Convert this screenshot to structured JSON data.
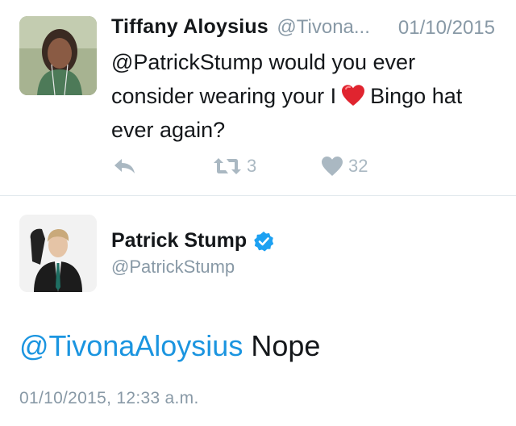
{
  "tweet1": {
    "name": "Tiffany Aloysius",
    "handle": "@Tivona...",
    "date": "01/10/2015",
    "text_before_emoji": "@PatrickStump would you ever consider wearing your I",
    "emoji": "red-heart",
    "text_after_emoji": "Bingo hat ever again?",
    "retweet_count": "3",
    "like_count": "32"
  },
  "tweet2": {
    "name": "Patrick Stump",
    "handle": "@PatrickStump",
    "mention": "@TivonaAloysius",
    "text": "Nope",
    "timestamp": "01/10/2015, 12:33 a.m."
  },
  "colors": {
    "mention": "#1b95e0",
    "secondary_text": "#8899a6",
    "action_icons": "#aab8c2",
    "verified_badge": "#1da1f2",
    "divider": "#e1e8ed",
    "heart_emoji": "#e0242f"
  },
  "icons": {
    "reply": "reply-arrow-icon",
    "retweet": "retweet-icon",
    "like": "heart-icon",
    "verified": "verified-badge-icon"
  }
}
